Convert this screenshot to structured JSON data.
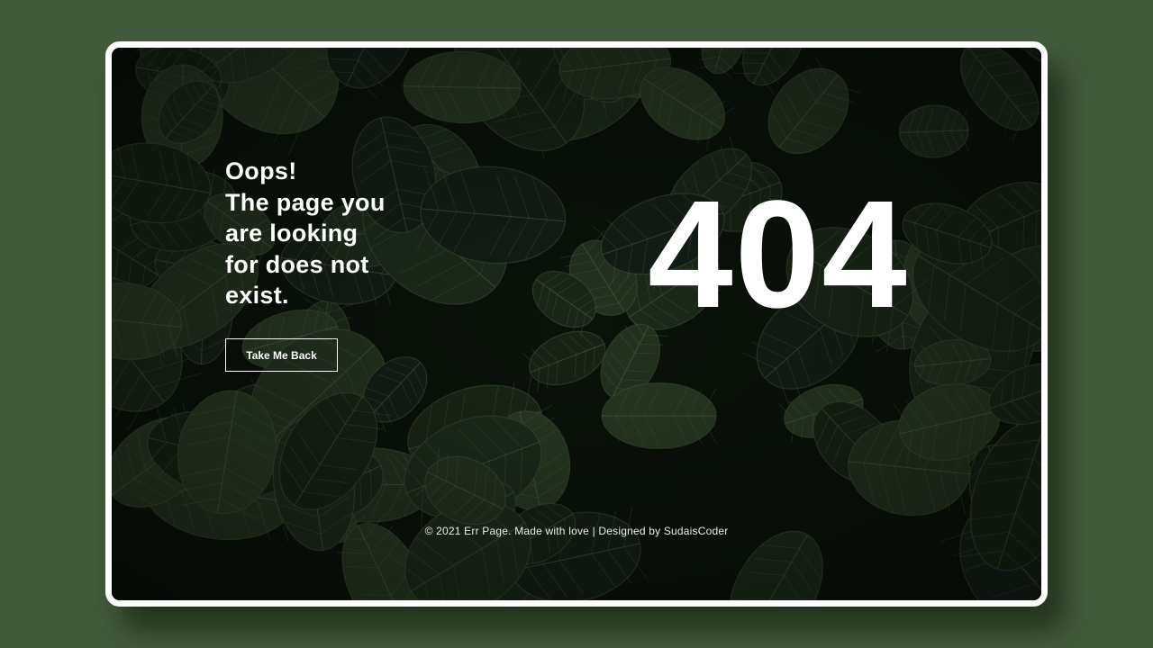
{
  "colors": {
    "page_background": "#435a3c",
    "card_border": "#ffffff",
    "text": "#ffffff"
  },
  "background_image": "dark green fittonia leaves",
  "message": {
    "line1": "Oops!",
    "line2": "The page you",
    "line3": "are looking",
    "line4": "for does not",
    "line5": "exist."
  },
  "button": {
    "label": "Take Me Back"
  },
  "error_code": "404",
  "footer": {
    "text": "© 2021 Err Page. Made with love | Designed by SudaisCoder"
  }
}
